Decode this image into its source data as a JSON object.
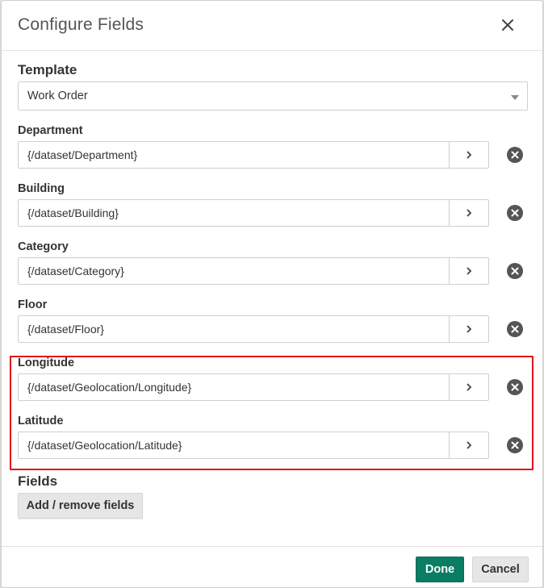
{
  "dialog": {
    "title": "Configure Fields"
  },
  "template": {
    "label": "Template",
    "selected": "Work Order"
  },
  "fields": [
    {
      "label": "Department",
      "value": "{/dataset/Department}"
    },
    {
      "label": "Building",
      "value": "{/dataset/Building}"
    },
    {
      "label": "Category",
      "value": "{/dataset/Category}"
    },
    {
      "label": "Floor",
      "value": "{/dataset/Floor}"
    },
    {
      "label": "Longitude",
      "value": "{/dataset/Geolocation/Longitude}"
    },
    {
      "label": "Latitude",
      "value": "{/dataset/Geolocation/Latitude}"
    }
  ],
  "fields_section": {
    "label": "Fields",
    "add_button": "Add / remove fields"
  },
  "footer": {
    "done_label": "Done",
    "cancel_label": "Cancel"
  },
  "colors": {
    "primary": "#0a7d62",
    "highlight": "#e0141b",
    "remove_icon": "#555555"
  },
  "icons": {
    "close": "close-icon",
    "chevron": "chevron-right-icon",
    "remove": "remove-circle-icon",
    "dropdown": "caret-down-icon"
  }
}
